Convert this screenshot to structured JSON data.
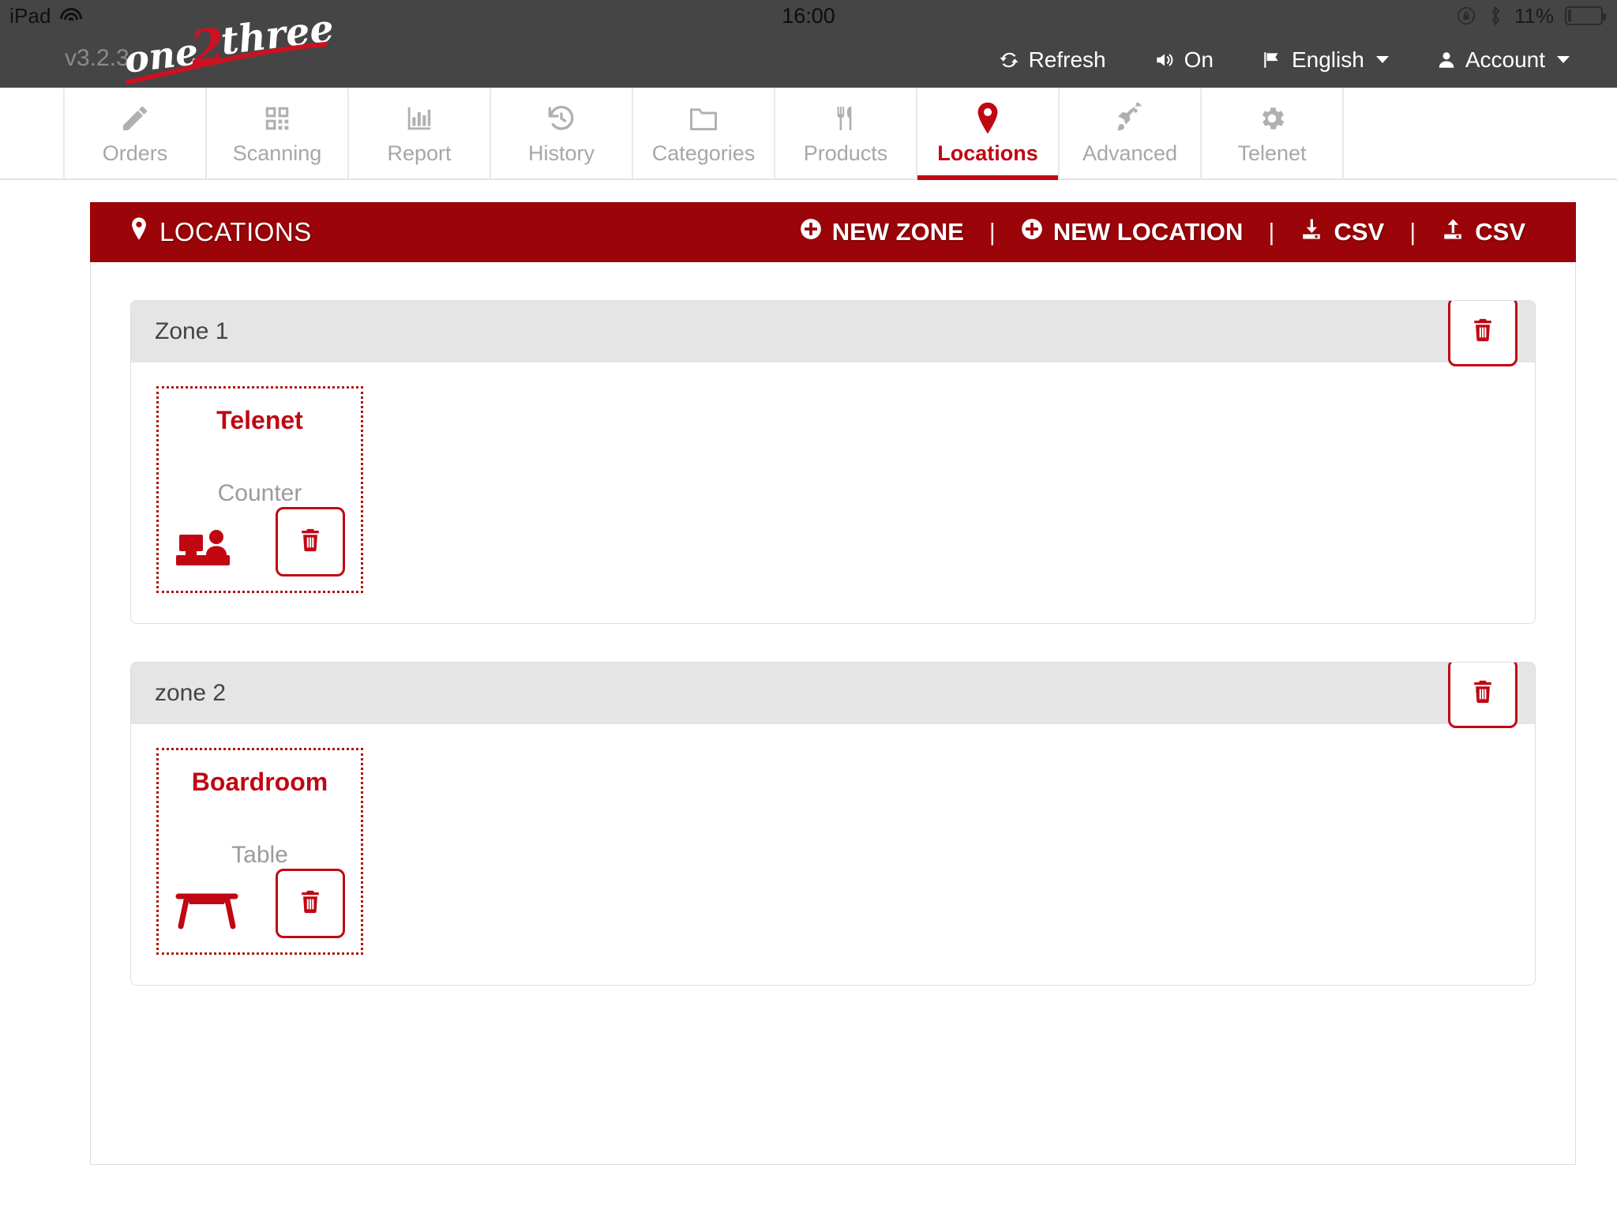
{
  "status_bar": {
    "device": "iPad",
    "wifi_icon": "wifi-icon",
    "time": "16:00",
    "rotation_lock_icon": "rotation-lock-icon",
    "bluetooth_icon": "bluetooth-icon",
    "battery_percent": "11%",
    "battery_icon": "battery-icon"
  },
  "app_header": {
    "version": "v3.2.3",
    "logo_text": "one2three",
    "logo_part_1": "one",
    "logo_part_2": "2",
    "logo_part_3": "three",
    "menu": [
      {
        "label": "Refresh",
        "icon": "refresh-icon",
        "caret": false
      },
      {
        "label": "On",
        "icon": "volume-on-icon",
        "caret": false
      },
      {
        "label": "English",
        "icon": "flag-icon",
        "caret": true
      },
      {
        "label": "Account",
        "icon": "user-icon",
        "caret": true
      }
    ]
  },
  "nav_tabs": [
    {
      "label": "Orders",
      "icon": "pencil-icon",
      "active": false
    },
    {
      "label": "Scanning",
      "icon": "qrcode-icon",
      "active": false
    },
    {
      "label": "Report",
      "icon": "barchart-icon",
      "active": false
    },
    {
      "label": "History",
      "icon": "history-icon",
      "active": false
    },
    {
      "label": "Categories",
      "icon": "folder-icon",
      "active": false
    },
    {
      "label": "Products",
      "icon": "cutlery-icon",
      "active": false
    },
    {
      "label": "Locations",
      "icon": "map-pin-icon",
      "active": true
    },
    {
      "label": "Advanced",
      "icon": "rocket-icon",
      "active": false
    },
    {
      "label": "Telenet",
      "icon": "gear-icon",
      "active": false
    }
  ],
  "panel": {
    "title": "LOCATIONS",
    "title_icon": "map-pin-icon",
    "actions": [
      {
        "label": "NEW ZONE",
        "icon": "plus-circle-icon"
      },
      {
        "label": "NEW LOCATION",
        "icon": "plus-circle-icon"
      },
      {
        "label": "CSV",
        "icon": "download-icon"
      },
      {
        "label": "CSV",
        "icon": "upload-icon"
      }
    ],
    "separator": "|"
  },
  "zones": [
    {
      "name": "Zone 1",
      "delete_icon": "trash-icon",
      "locations": [
        {
          "name": "Telenet",
          "type": "Counter",
          "icon": "counter-icon",
          "delete_icon": "trash-icon"
        }
      ]
    },
    {
      "name": "zone 2",
      "delete_icon": "trash-icon",
      "locations": [
        {
          "name": "Boardroom",
          "type": "Table",
          "icon": "table-icon",
          "delete_icon": "trash-icon"
        }
      ]
    }
  ],
  "colors": {
    "brand_red": "#c00712",
    "header_red": "#9b0408",
    "dark_bar": "#454545",
    "zone_head_gray": "#e5e5e5",
    "muted_text": "#a7a7a7"
  }
}
